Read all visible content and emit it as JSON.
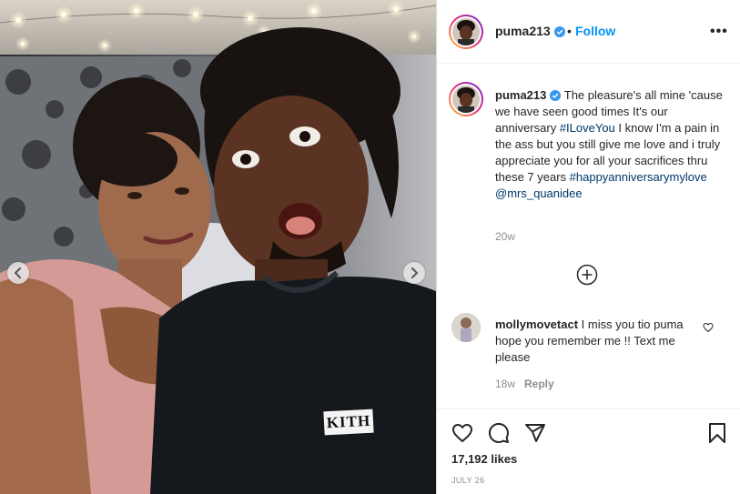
{
  "post": {
    "photo": {
      "shirt_text": "KITH",
      "prev_icon": "chevron-left-icon",
      "next_icon": "chevron-right-icon"
    },
    "header": {
      "username": "puma213",
      "separator": "•",
      "follow_label": "Follow",
      "more_label": "•••",
      "verified_icon": "verified-badge-icon"
    },
    "caption": {
      "username": "puma213",
      "text_1": " The pleasure's all mine 'cause we have seen good times It's our anniversary ",
      "hashtag_1": "#ILoveYou",
      "text_2": " I know I'm a pain in the ass but you still give me love and i truly appreciate you for all your sacrifices thru these 7 years ",
      "hashtag_2": "#happyanniversarymylove",
      "mention": "@mrs_quanidee",
      "time": "20w"
    },
    "load_more_icon": "plus-circle-icon",
    "comments": [
      {
        "username": "mollymovetact",
        "text": " I miss you tio puma hope you remember me !! Text me please",
        "time": "18w",
        "reply_label": "Reply"
      }
    ],
    "actions": {
      "like_icon": "heart-icon",
      "comment_icon": "comment-icon",
      "share_icon": "share-icon",
      "save_icon": "bookmark-icon"
    },
    "likes": "17,192 likes",
    "date": "JULY 26"
  },
  "colors": {
    "link_blue": "#0095f6",
    "hashtag": "#00376b",
    "secondary": "#8e8e8e",
    "text": "#262626",
    "verified": "#3897f0"
  }
}
